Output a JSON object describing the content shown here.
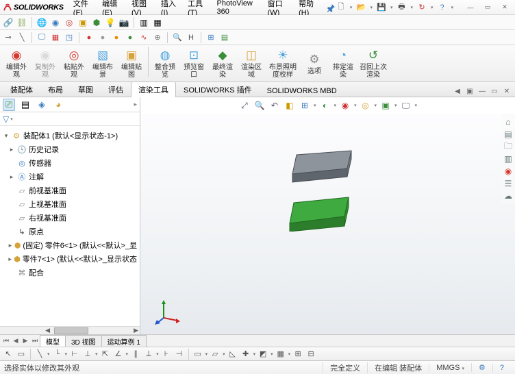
{
  "app": {
    "name": "SOLIDWORKS"
  },
  "menus": [
    "文件(F)",
    "编辑(E)",
    "视图(V)",
    "插入(I)",
    "工具(T)",
    "PhotoView 360",
    "窗口(W)",
    "帮助(H)"
  ],
  "commands": [
    {
      "label": "编辑外观",
      "icon": "sphere-edit",
      "color": "#d63a2e"
    },
    {
      "label": "复制外观",
      "icon": "sphere-copy",
      "color": "#bfbfbf"
    },
    {
      "label": "粘贴外观",
      "icon": "sphere-paste",
      "color": "#d63a2e"
    },
    {
      "label": "编辑布景",
      "icon": "scene",
      "color": "#4aa3df"
    },
    {
      "label": "编辑贴图",
      "icon": "decal",
      "color": "#d6a23a"
    },
    {
      "label": "整合预览",
      "icon": "preview-int",
      "color": "#4aa3df"
    },
    {
      "label": "预览窗口",
      "icon": "preview-win",
      "color": "#4aa3df"
    },
    {
      "label": "最终渲染",
      "icon": "render",
      "color": "#3a8e3a"
    },
    {
      "label": "渲染区域",
      "icon": "region",
      "color": "#d6a23a"
    },
    {
      "label": "布景照明度校样",
      "icon": "lighting",
      "color": "#4aa3df"
    },
    {
      "label": "选项",
      "icon": "options",
      "color": "#888"
    },
    {
      "label": "排定渲染",
      "icon": "schedule",
      "color": "#4aa3df"
    },
    {
      "label": "召回上次渲染",
      "icon": "recall",
      "color": "#3a8e3a"
    }
  ],
  "tabs": [
    "装配体",
    "布局",
    "草图",
    "评估",
    "渲染工具",
    "SOLIDWORKS 插件",
    "SOLIDWORKS MBD"
  ],
  "active_tab": 4,
  "tree": {
    "root": "装配体1 (默认<显示状态-1>)",
    "items": [
      {
        "icon": "history",
        "label": "历史记录",
        "caret": "▸"
      },
      {
        "icon": "sensor",
        "label": "传感器"
      },
      {
        "icon": "annotation",
        "label": "注解",
        "caret": "▸"
      },
      {
        "icon": "plane",
        "label": "前视基准面"
      },
      {
        "icon": "plane",
        "label": "上视基准面"
      },
      {
        "icon": "plane",
        "label": "右视基准面"
      },
      {
        "icon": "origin",
        "label": "原点"
      },
      {
        "icon": "part",
        "label": "(固定) 零件6<1> (默认<<默认>_显",
        "caret": "▸"
      },
      {
        "icon": "part",
        "label": "零件7<1> (默认<<默认>_显示状态",
        "caret": "▸"
      },
      {
        "icon": "mate",
        "label": "配合"
      }
    ]
  },
  "view_tabs": [
    "模型",
    "3D 视图",
    "运动算例 1"
  ],
  "active_view_tab": 0,
  "status": {
    "hint": "选择实体以修改其外观",
    "def": "完全定义",
    "edit": "在编辑 装配体",
    "units": "MMGS"
  }
}
